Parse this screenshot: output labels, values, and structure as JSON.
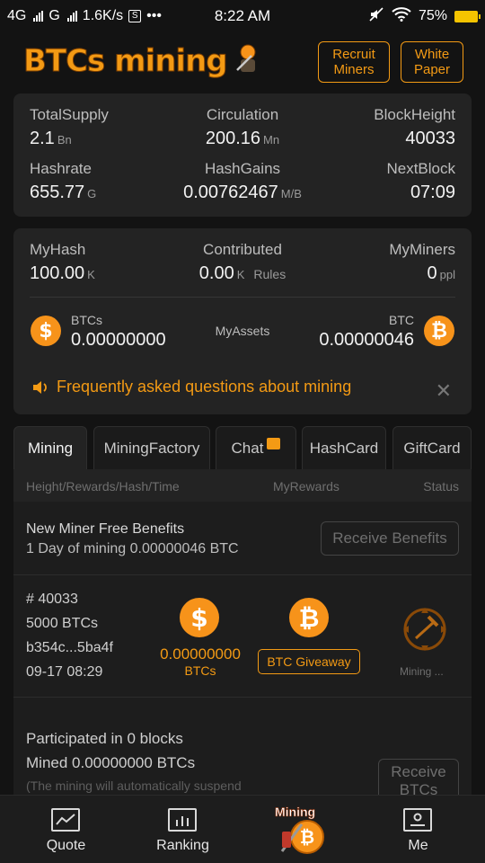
{
  "status_bar": {
    "network1": "4G",
    "network2": "G",
    "speed": "1.6K/s",
    "time": "8:22 AM",
    "battery_pct": "75%",
    "icons": [
      "signal-icon",
      "screenshot-icon",
      "more-icon",
      "mute-icon",
      "wifi-icon",
      "battery-icon"
    ]
  },
  "header": {
    "logo_text": "BTCs mining",
    "recruit_label": "Recruit Miners",
    "white_paper_label": "White Paper"
  },
  "network_stats": {
    "total_supply": {
      "label": "TotalSupply",
      "value": "2.1",
      "unit": "Bn"
    },
    "circulation": {
      "label": "Circulation",
      "value": "200.16",
      "unit": "Mn"
    },
    "block_height": {
      "label": "BlockHeight",
      "value": "40033"
    },
    "hashrate": {
      "label": "Hashrate",
      "value": "655.77",
      "unit": "G"
    },
    "hash_gains": {
      "label": "HashGains",
      "value": "0.00762467",
      "unit": "M/B"
    },
    "next_block": {
      "label": "NextBlock",
      "value": "07:09"
    }
  },
  "my_stats": {
    "my_hash": {
      "label": "MyHash",
      "value": "100.00",
      "unit": "K"
    },
    "contributed": {
      "label": "Contributed",
      "value": "0.00",
      "unit": "K",
      "rules": "Rules"
    },
    "my_miners": {
      "label": "MyMiners",
      "value": "0",
      "unit": "ppl"
    },
    "assets_label": "MyAssets",
    "btcs": {
      "label": "BTCs",
      "value": "0.00000000"
    },
    "btc": {
      "label": "BTC",
      "value": "0.00000046"
    },
    "faq_text": "Frequently asked questions about mining",
    "close_glyph": "✕"
  },
  "tabs": [
    {
      "label": "Mining",
      "active": true
    },
    {
      "label": "MiningFactory"
    },
    {
      "label": "Chat"
    },
    {
      "label": "HashCard"
    },
    {
      "label": "GiftCard"
    }
  ],
  "table": {
    "col_left": "Height/Rewards/Hash/Time",
    "col_mid": "MyRewards",
    "col_right": "Status"
  },
  "benefit": {
    "title": "New Miner Free Benefits",
    "subtitle": "1 Day of mining 0.00000046 BTC",
    "button": "Receive Benefits"
  },
  "block_row": {
    "height": "# 40033",
    "reward": "5000 BTCs",
    "hash": "b354c...5ba4f",
    "time": "09-17 08:29",
    "my_reward_value": "0.00000000",
    "my_reward_unit": "BTCs",
    "giveaway_label": "BTC Giveaway",
    "status_label": "Mining ..."
  },
  "participation": {
    "blocks_text": "Participated in 0 blocks",
    "mined_text": "Mined 0.00000000 BTCs",
    "note_text": "(The mining will automatically suspend",
    "button": "Receive BTCs"
  },
  "bottom_nav": {
    "quote": "Quote",
    "ranking": "Ranking",
    "mining": "Mining",
    "me": "Me"
  },
  "colors": {
    "accent": "#f39a14",
    "coin": "#f7931a",
    "background": "#131313",
    "card": "#232323"
  }
}
